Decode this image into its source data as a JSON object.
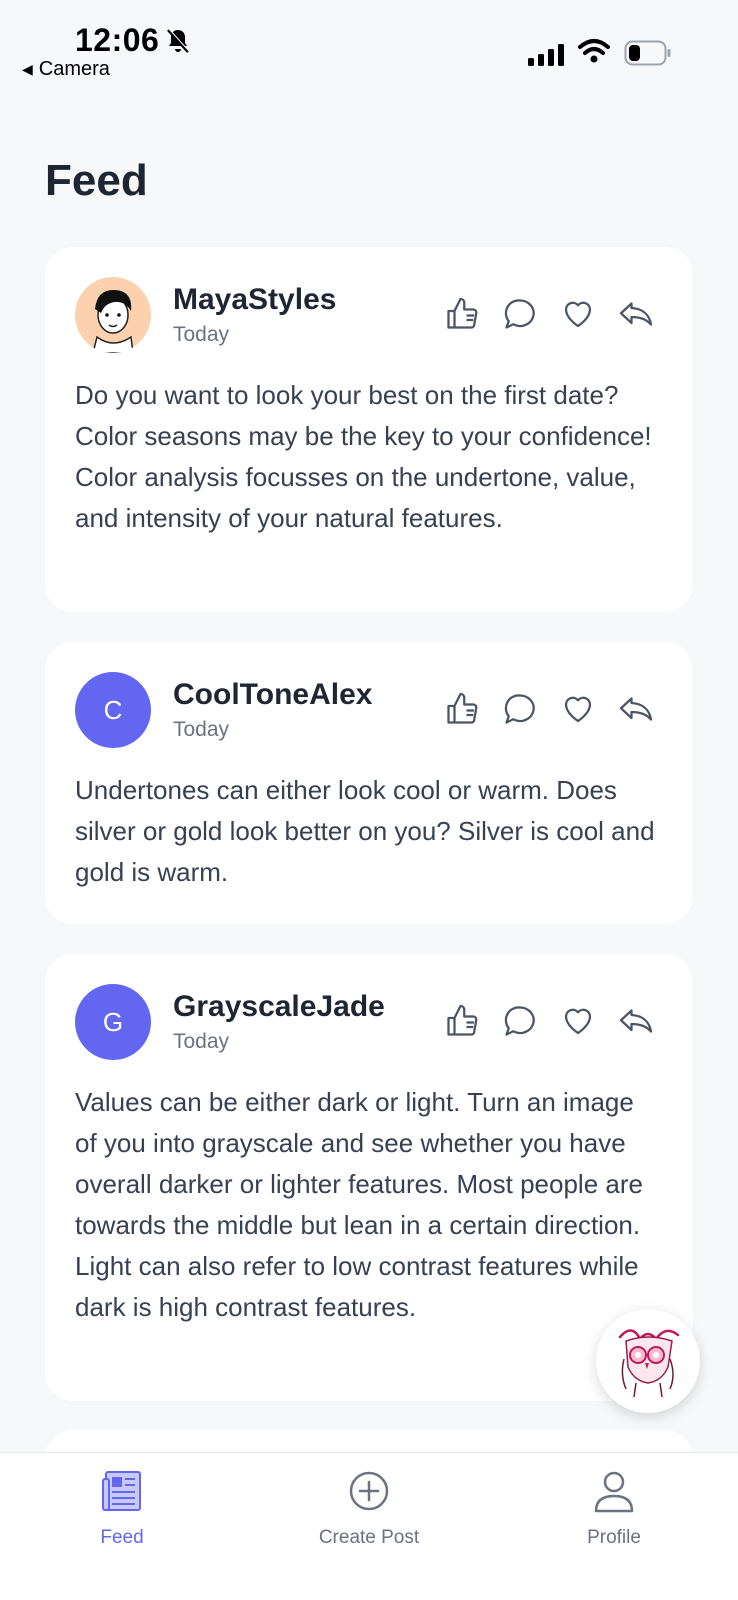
{
  "status_bar": {
    "time": "12:06",
    "back_app": "Camera"
  },
  "page": {
    "title": "Feed"
  },
  "posts": [
    {
      "username": "MayaStyles",
      "time": "Today",
      "avatar_type": "photo",
      "text": "Do you want to look your best on the first date? Color seasons may be the key to your confidence! Color analysis focusses on the undertone, value, and intensity of your natural features."
    },
    {
      "username": "CoolToneAlex",
      "time": "Today",
      "avatar_type": "initial",
      "initial": "C",
      "text": "Undertones can either look cool or warm. Does silver or gold look better on you? Silver is cool and gold is warm."
    },
    {
      "username": "GrayscaleJade",
      "time": "Today",
      "avatar_type": "initial",
      "initial": "G",
      "text": "Values can be either dark or light. Turn an image of you into grayscale and see whether you have overall darker or lighter features. Most people are towards the middle but lean in a certain direction. Light can also refer to low contrast features while dark is high contrast features."
    }
  ],
  "post_actions": [
    "thumbs-up-icon",
    "comment-icon",
    "heart-icon",
    "share-icon"
  ],
  "bottom_nav": {
    "items": [
      {
        "label": "Feed",
        "icon": "newspaper-icon",
        "active": true
      },
      {
        "label": "Create Post",
        "icon": "plus-circle-icon",
        "active": false
      },
      {
        "label": "Profile",
        "icon": "user-icon",
        "active": false
      }
    ]
  },
  "colors": {
    "accent": "#6366f1",
    "background": "#f7f8fa",
    "card": "#ffffff",
    "text_primary": "#1e2533",
    "text_secondary": "#6b7280"
  }
}
